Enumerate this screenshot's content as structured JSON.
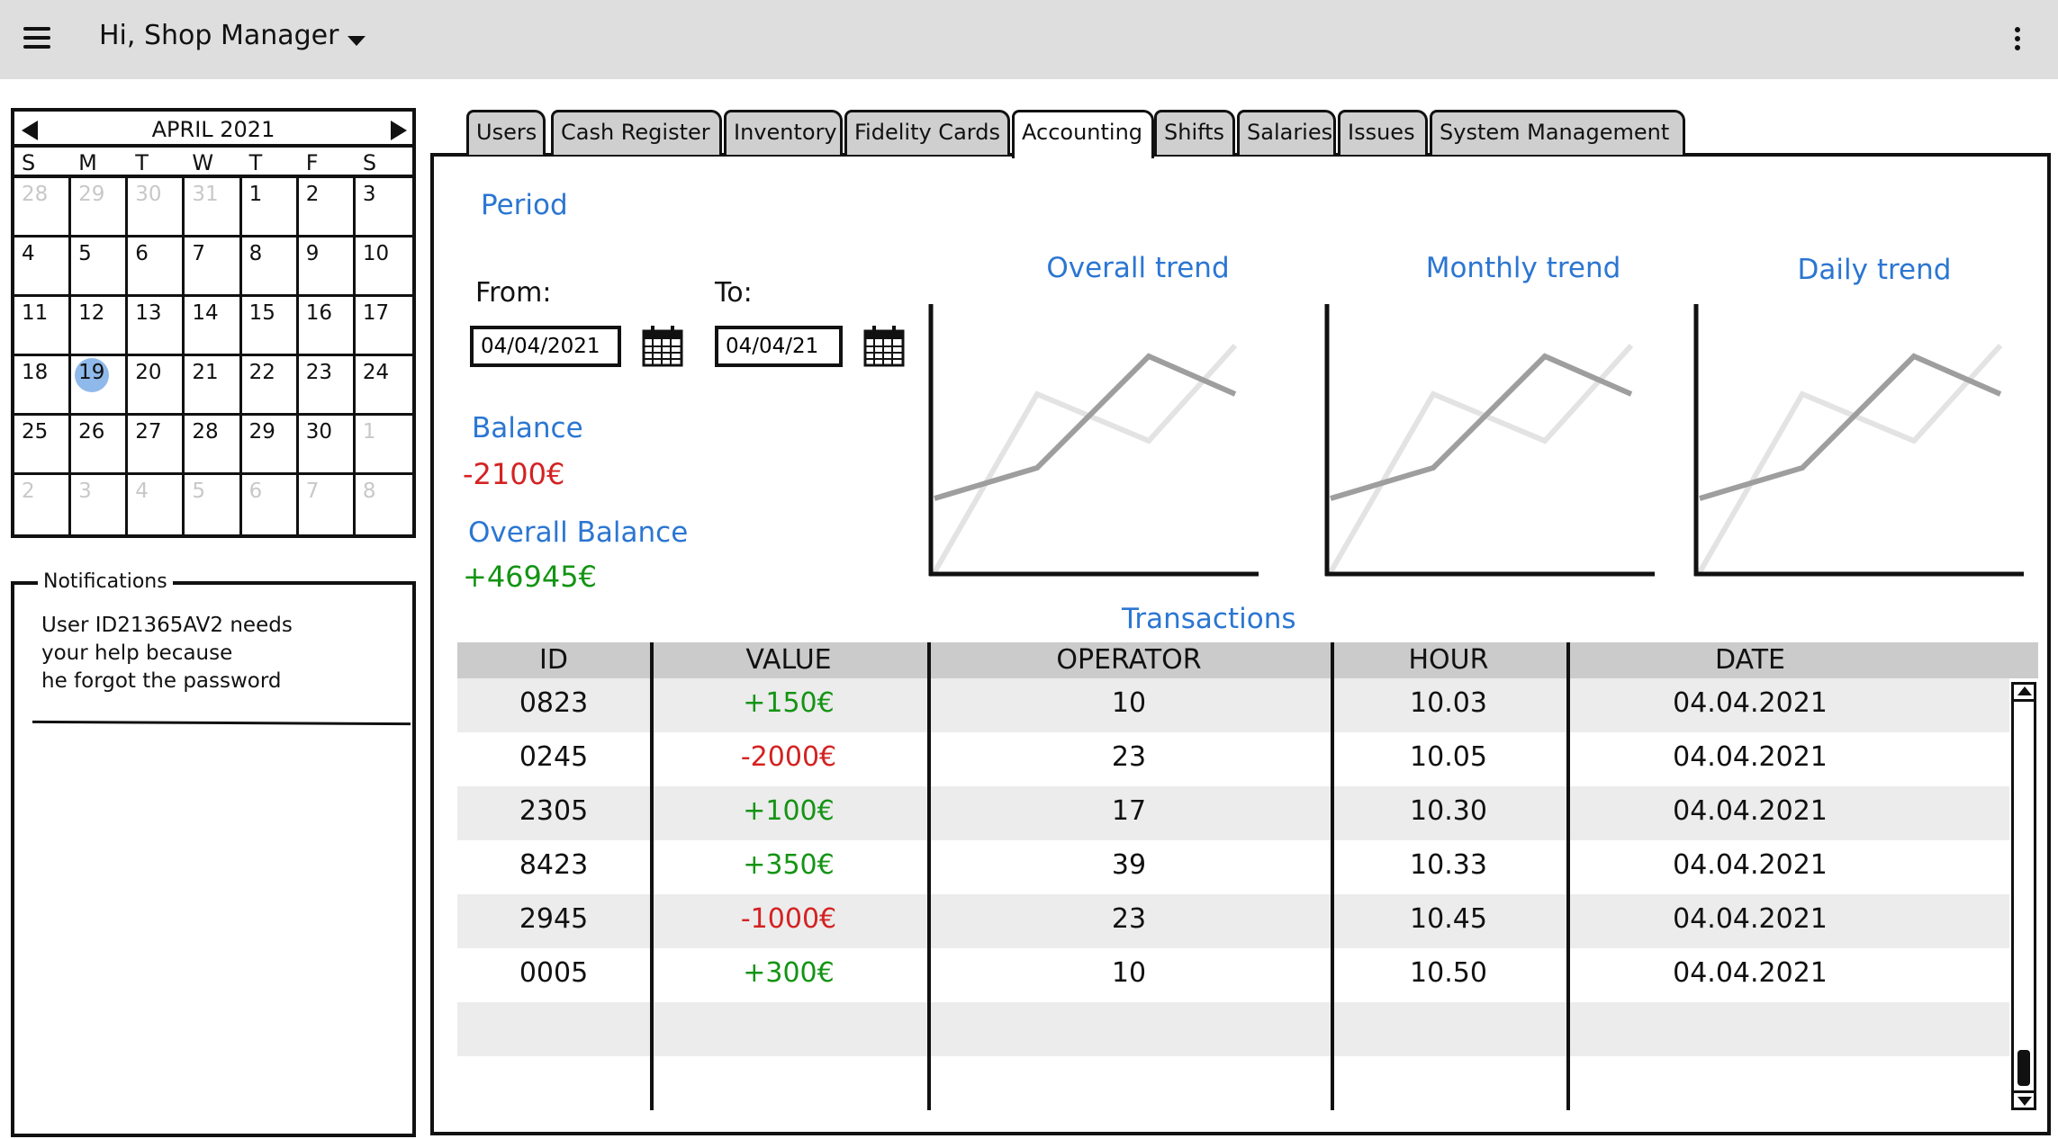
{
  "header": {
    "greeting": "Hi, Shop Manager"
  },
  "calendar": {
    "title": "APRIL 2021",
    "weekdays": [
      "S",
      "M",
      "T",
      "W",
      "T",
      "F",
      "S"
    ],
    "days": [
      {
        "d": "28",
        "muted": true
      },
      {
        "d": "29",
        "muted": true
      },
      {
        "d": "30",
        "muted": true
      },
      {
        "d": "31",
        "muted": true
      },
      {
        "d": "1"
      },
      {
        "d": "2"
      },
      {
        "d": "3"
      },
      {
        "d": "4"
      },
      {
        "d": "5"
      },
      {
        "d": "6"
      },
      {
        "d": "7"
      },
      {
        "d": "8"
      },
      {
        "d": "9"
      },
      {
        "d": "10"
      },
      {
        "d": "11"
      },
      {
        "d": "12"
      },
      {
        "d": "13"
      },
      {
        "d": "14"
      },
      {
        "d": "15"
      },
      {
        "d": "16"
      },
      {
        "d": "17"
      },
      {
        "d": "18"
      },
      {
        "d": "19",
        "selected": true
      },
      {
        "d": "20"
      },
      {
        "d": "21"
      },
      {
        "d": "22"
      },
      {
        "d": "23"
      },
      {
        "d": "24"
      },
      {
        "d": "25"
      },
      {
        "d": "26"
      },
      {
        "d": "27"
      },
      {
        "d": "28"
      },
      {
        "d": "29"
      },
      {
        "d": "30"
      },
      {
        "d": "1",
        "muted": true
      },
      {
        "d": "2",
        "muted": true
      },
      {
        "d": "3",
        "muted": true
      },
      {
        "d": "4",
        "muted": true
      },
      {
        "d": "5",
        "muted": true
      },
      {
        "d": "6",
        "muted": true
      },
      {
        "d": "7",
        "muted": true
      },
      {
        "d": "8",
        "muted": true
      }
    ]
  },
  "notifications": {
    "title": "Notifications",
    "lines": [
      "User ID21365AV2 needs",
      "your help because",
      "he forgot the password"
    ]
  },
  "tabs": [
    {
      "label": "Users",
      "active": false
    },
    {
      "label": "Cash Register",
      "active": false
    },
    {
      "label": "Inventory",
      "active": false
    },
    {
      "label": "Fidelity Cards",
      "active": false
    },
    {
      "label": "Accounting",
      "active": true
    },
    {
      "label": "Shifts",
      "active": false
    },
    {
      "label": "Salaries",
      "active": false
    },
    {
      "label": "Issues",
      "active": false
    },
    {
      "label": "System Management",
      "active": false
    }
  ],
  "accounting": {
    "period_label": "Period",
    "from_label": "From:",
    "from_value": "04/04/2021",
    "to_label": "To:",
    "to_value": "04/04/21",
    "balance_label": "Balance",
    "balance_value": "-2100€",
    "overall_balance_label": "Overall Balance",
    "overall_balance_value": "+46945€",
    "trends": [
      {
        "title": "Overall trend"
      },
      {
        "title": "Monthly trend"
      },
      {
        "title": "Daily trend"
      }
    ],
    "transactions_title": "Transactions",
    "columns": [
      "ID",
      "VALUE",
      "OPERATOR",
      "HOUR",
      "DATE"
    ],
    "rows": [
      {
        "id": "0823",
        "value": "+150€",
        "positive": true,
        "operator": "10",
        "hour": "10.03",
        "date": "04.04.2021"
      },
      {
        "id": "0245",
        "value": "-2000€",
        "positive": false,
        "operator": "23",
        "hour": "10.05",
        "date": "04.04.2021"
      },
      {
        "id": "2305",
        "value": "+100€",
        "positive": true,
        "operator": "17",
        "hour": "10.30",
        "date": "04.04.2021"
      },
      {
        "id": "8423",
        "value": "+350€",
        "positive": true,
        "operator": "39",
        "hour": "10.33",
        "date": "04.04.2021"
      },
      {
        "id": "2945",
        "value": "-1000€",
        "positive": false,
        "operator": "23",
        "hour": "10.45",
        "date": "04.04.2021"
      },
      {
        "id": "0005",
        "value": "+300€",
        "positive": true,
        "operator": "10",
        "hour": "10.50",
        "date": "04.04.2021"
      }
    ]
  },
  "colors": {
    "accent": "#2b76d2",
    "positive": "#149414",
    "negative": "#d42222",
    "header_bg": "#dedede"
  }
}
